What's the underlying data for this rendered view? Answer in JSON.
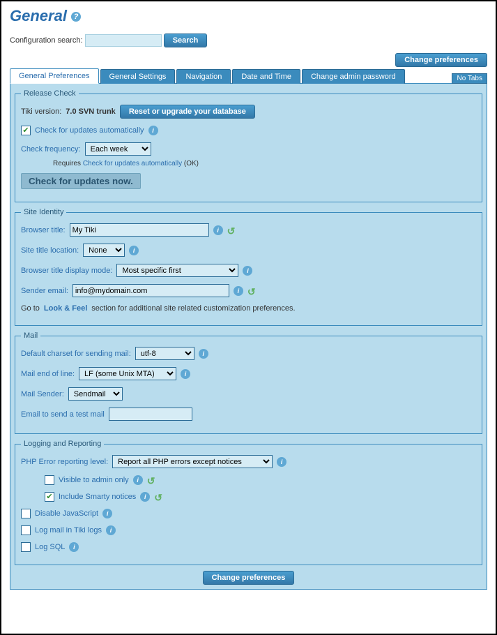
{
  "page_title": "General",
  "search": {
    "label": "Configuration search:",
    "button": "Search"
  },
  "change_prefs": "Change preferences",
  "tabs": [
    "General Preferences",
    "General Settings",
    "Navigation",
    "Date and Time",
    "Change admin password"
  ],
  "no_tabs": "No Tabs",
  "release_check": {
    "legend": "Release Check",
    "tiki_version_label": "Tiki version:",
    "tiki_version": "7.0 SVN trunk",
    "reset_btn": "Reset or upgrade your database",
    "check_updates": "Check for updates automatically",
    "check_freq_label": "Check frequency:",
    "check_freq_value": "Each week",
    "requires_prefix": "Requires",
    "requires_link": "Check for updates automatically",
    "requires_suffix": "(OK)",
    "check_now": "Check for updates now."
  },
  "site_identity": {
    "legend": "Site Identity",
    "browser_title_label": "Browser title:",
    "browser_title": "My Tiki",
    "site_title_loc_label": "Site title location:",
    "site_title_loc": "None",
    "display_mode_label": "Browser title display mode:",
    "display_mode": "Most specific first",
    "sender_email_label": "Sender email:",
    "sender_email": "info@mydomain.com",
    "goto_prefix": "Go to",
    "goto_link": "Look & Feel",
    "goto_suffix": "section for additional site related customization preferences."
  },
  "mail": {
    "legend": "Mail",
    "charset_label": "Default charset for sending mail:",
    "charset": "utf-8",
    "eol_label": "Mail end of line:",
    "eol": "LF (some Unix MTA)",
    "sender_label": "Mail Sender:",
    "sender": "Sendmail",
    "test_label": "Email to send a test mail"
  },
  "logging": {
    "legend": "Logging and Reporting",
    "php_label": "PHP Error reporting level:",
    "php_value": "Report all PHP errors except notices",
    "visible_admin": "Visible to admin only",
    "smarty": "Include Smarty notices",
    "disable_js": "Disable JavaScript",
    "log_mail": "Log mail in Tiki logs",
    "log_sql": "Log SQL"
  }
}
